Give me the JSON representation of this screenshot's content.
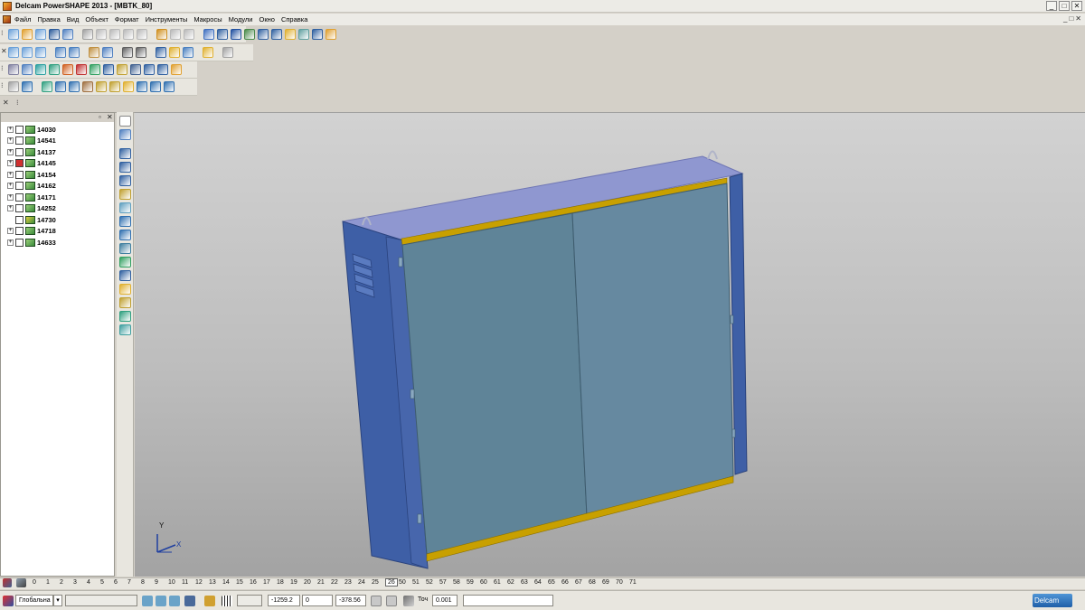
{
  "window": {
    "title": "Delcam PowerSHAPE 2013 - [MBTK_80]",
    "min_symbol": "_",
    "max_symbol": "□",
    "close_symbol": "✕"
  },
  "menu": {
    "items": [
      "Файл",
      "Правка",
      "Вид",
      "Объект",
      "Формат",
      "Инструменты",
      "Макросы",
      "Модули",
      "Окно",
      "Справка"
    ],
    "mdi_controls": [
      "_",
      "□",
      "✕"
    ]
  },
  "toolbars": {
    "grip_symbol": "⁝",
    "close_symbol": "✕"
  },
  "tree": {
    "header_pin": "▫",
    "header_close": "✕",
    "items": [
      {
        "label": "14030",
        "expanded": true
      },
      {
        "label": "14541",
        "expanded": true
      },
      {
        "label": "14137",
        "expanded": true
      },
      {
        "label": "14145",
        "expanded": true,
        "flag": true
      },
      {
        "label": "14154",
        "expanded": true
      },
      {
        "label": "14162",
        "expanded": true
      },
      {
        "label": "14171",
        "expanded": true
      },
      {
        "label": "14252",
        "expanded": true
      },
      {
        "label": "14730",
        "expanded": false,
        "active": true
      },
      {
        "label": "14718",
        "expanded": true
      },
      {
        "label": "14633",
        "expanded": true
      }
    ]
  },
  "viewport": {
    "axis_y": "Y",
    "axis_x": "X",
    "colors": {
      "cabinet_side": "#3e5fa6",
      "cabinet_top": "#8f97d0",
      "door_panel": "#5f8498",
      "door_trim": "#c8a000"
    }
  },
  "layers": {
    "values": [
      "0",
      "1",
      "2",
      "3",
      "4",
      "5",
      "6",
      "7",
      "8",
      "9",
      "10",
      "11",
      "12",
      "13",
      "14",
      "15",
      "16",
      "17",
      "18",
      "19",
      "20",
      "21",
      "22",
      "23",
      "24",
      "25",
      "26",
      "50",
      "51",
      "52",
      "57",
      "58",
      "59",
      "60",
      "61",
      "62",
      "63",
      "64",
      "65",
      "66",
      "67",
      "68",
      "69",
      "70",
      "71"
    ],
    "active": "26"
  },
  "statusbar": {
    "workplane": "Глобальна",
    "x": "-1259.2",
    "y": "0",
    "z": "-378.56",
    "tolerance_label": "Точ",
    "tolerance": "0.001",
    "brand": "Delcam"
  }
}
